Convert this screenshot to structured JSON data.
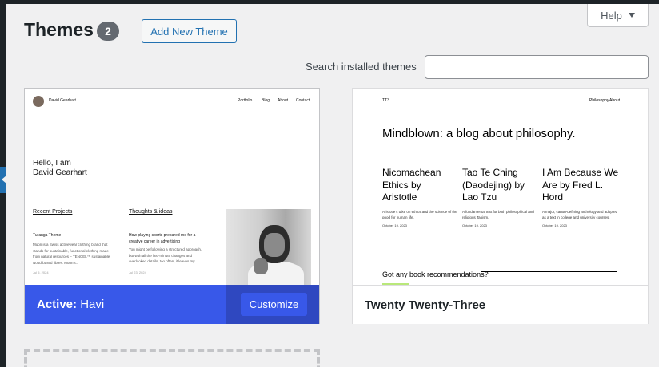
{
  "header": {
    "title": "Themes",
    "count": "2",
    "add_new_label": "Add New Theme",
    "help_label": "Help"
  },
  "search": {
    "label": "Search installed themes",
    "placeholder": "",
    "value": ""
  },
  "themes": [
    {
      "name": "Havi",
      "active_prefix": "Active:",
      "customize_label": "Customize",
      "preview": {
        "site_name": "David Gearhart",
        "nav": [
          "Portfolio",
          "Blog",
          "About",
          "Contact"
        ],
        "hero": [
          "Hello, I am",
          "David Gearhart"
        ],
        "col1_heading": "Recent Projects",
        "col1_item_title": "Turanga Theme",
        "col1_item_text": [
          "Muon is a Swiss activewear clothing brand that",
          "stands for sustainable, functional clothing made",
          "from natural resources – TENCEL™ sustainable",
          "wood-based fibres. Muon's..."
        ],
        "col1_date": "Jul 5, 2024",
        "col2_heading": "Thoughts & ideas",
        "col2_item_title": [
          "How playing sports prepared me for a",
          "creative career in advertising"
        ],
        "col2_item_text": [
          "You might be following a structured approach,",
          "but with all the last-minute changes and",
          "overlooked details, too often, it leaves my..."
        ],
        "col2_date": "Jul 23, 2024"
      }
    },
    {
      "name": "Twenty Twenty-Three",
      "preview": {
        "logo": "TT3",
        "nav": [
          "Philosophy",
          "About"
        ],
        "headline": "Mindblown: a blog about philosophy.",
        "books": [
          {
            "title": [
              "Nicomachean",
              "Ethics by",
              "Aristotle"
            ],
            "desc": [
              "Aristotle's take on ethics and the science of the",
              "good for human life."
            ],
            "date": "October 19, 2023"
          },
          {
            "title": [
              "Tao Te Ching",
              "(Daodejing) by",
              "Lao Tzu"
            ],
            "desc": [
              "A fundamental text for both philosophical and",
              "religious Taoism."
            ],
            "date": "October 19, 2023"
          },
          {
            "title": [
              "I Am Because We",
              "Are by Fred L.",
              "Hord"
            ],
            "desc": [
              "A major, canon-defining anthology and adopted",
              "as a text in college and university courses."
            ],
            "date": "October 19, 2023"
          }
        ],
        "recs": "Got any book recommendations?"
      }
    }
  ],
  "colors": {
    "accent": "#2271b1",
    "active_bar": "#3858e9",
    "admin_bar": "#1d2327"
  }
}
